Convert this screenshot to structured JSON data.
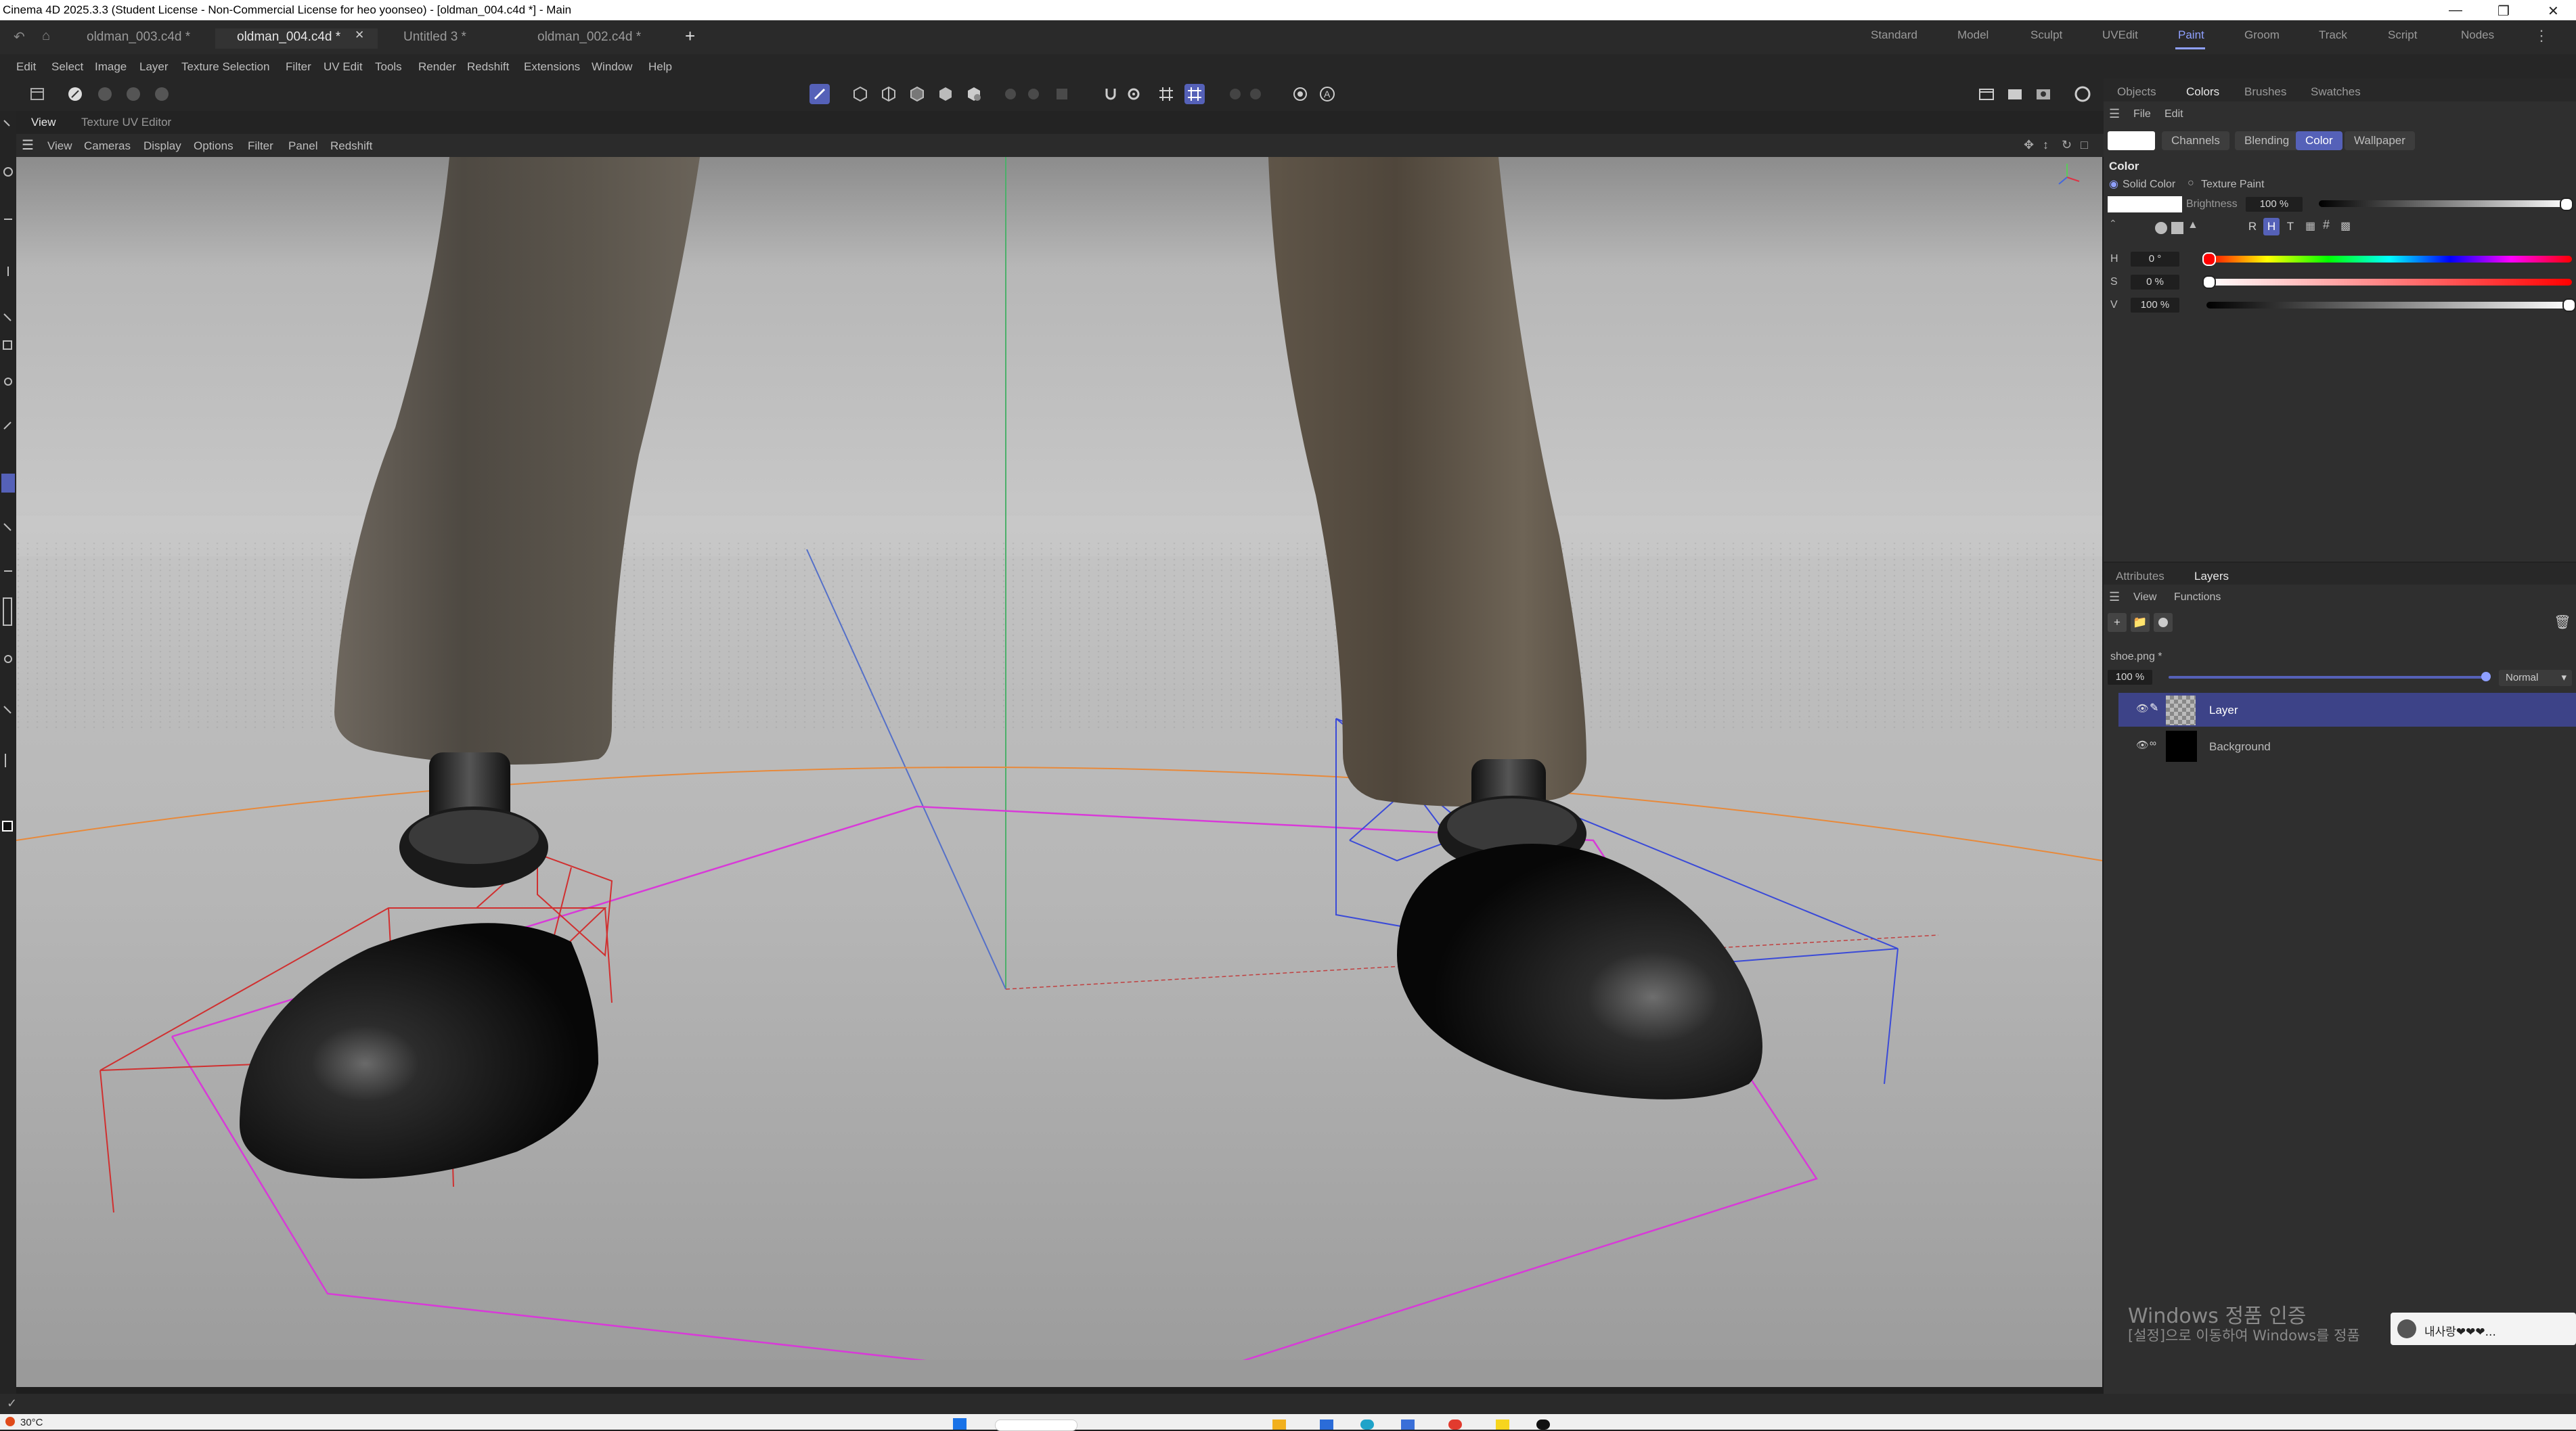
{
  "window": {
    "title": "Cinema 4D 2025.3.3 (Student License - Non-Commercial License for heo yoonseo) - [oldman_004.c4d *] - Main"
  },
  "doc_tabs": [
    {
      "label": "oldman_003.c4d *"
    },
    {
      "label": "oldman_004.c4d *"
    },
    {
      "label": "Untitled 3 *"
    },
    {
      "label": "oldman_002.c4d *"
    }
  ],
  "layout_tabs": [
    "Standard",
    "Model",
    "Sculpt",
    "UVEdit",
    "Paint",
    "Groom",
    "Track",
    "Script",
    "Nodes"
  ],
  "active_layout": "Paint",
  "menu": [
    "Edit",
    "Select",
    "Image",
    "Layer",
    "Texture Selection",
    "Filter",
    "UV Edit",
    "Tools",
    "Render",
    "Redshift",
    "Extensions",
    "Window",
    "Help"
  ],
  "viewport": {
    "tabs": [
      "View",
      "Texture UV Editor"
    ],
    "menu": [
      "View",
      "Cameras",
      "Display",
      "Options",
      "Filter",
      "Panel",
      "Redshift"
    ]
  },
  "right_top": {
    "tabs": [
      "Objects",
      "Colors",
      "Brushes",
      "Swatches"
    ],
    "menu": [
      "File",
      "Edit"
    ],
    "mode_tabs": [
      "Channels",
      "Blending",
      "Color",
      "Wallpaper"
    ],
    "active_mode": "Color",
    "section_title": "Color",
    "solid_color": "Solid Color",
    "texture_paint": "Texture Paint",
    "brightness_label": "Brightness",
    "brightness_value": "100 %",
    "modes": [
      "R",
      "H",
      "T"
    ],
    "h_label": "H",
    "h_value": "0 °",
    "s_label": "S",
    "s_value": "0 %",
    "v_label": "V",
    "v_value": "100 %",
    "current_color": "#ffffff"
  },
  "right_bottom": {
    "tabs": [
      "Attributes",
      "Layers"
    ],
    "menu": [
      "View",
      "Functions"
    ],
    "file": "shoe.png *",
    "opacity": "100 %",
    "blend_mode": "Normal",
    "layers": [
      {
        "name": "Layer"
      },
      {
        "name": "Background"
      }
    ]
  },
  "activation": {
    "title": "Windows 정품 인증",
    "subtitle": "[설정]으로 이동하여 Windows를 정품"
  },
  "notification": {
    "text": "내사랑❤❤❤..."
  },
  "taskbar": {
    "weather": "30°C"
  },
  "colors": {
    "accent": "#5561b8",
    "active_tab_text": "#8fa0ff"
  }
}
